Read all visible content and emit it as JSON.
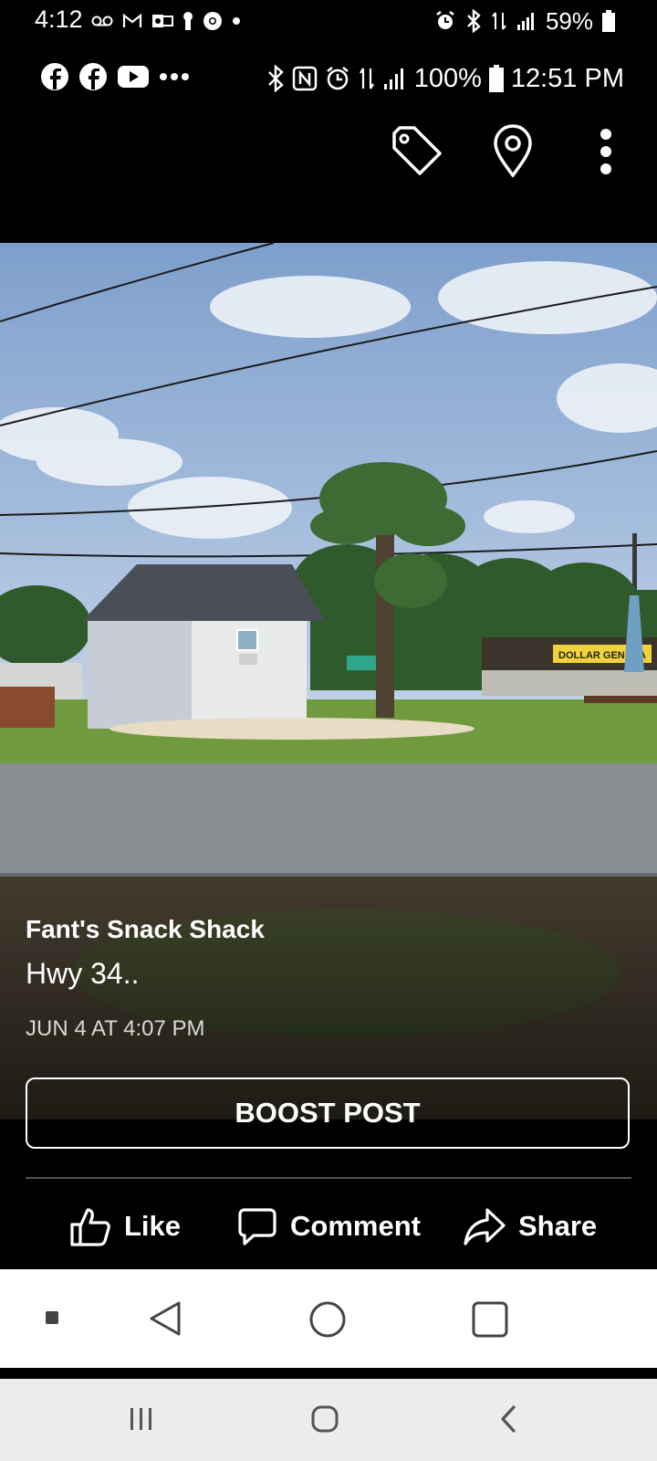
{
  "outer_status": {
    "time": "4:12",
    "battery": "59%",
    "icons": [
      "voicemail-icon",
      "gmail-icon",
      "outlook-icon",
      "keyhole-icon",
      "chrome-icon",
      "dot-icon",
      "alarm-icon",
      "bluetooth-icon",
      "data-icon",
      "signal-icon",
      "battery-icon"
    ]
  },
  "inner_status": {
    "battery": "100%",
    "time": "12:51 PM",
    "icons": [
      "facebook-icon",
      "facebook-icon",
      "youtube-icon",
      "more-dots-icon",
      "bluetooth-icon",
      "nfc-icon",
      "alarm-icon",
      "data-icon",
      "signal-icon",
      "battery-icon"
    ]
  },
  "toolbar": {
    "icons": [
      "tag-icon",
      "location-pin-icon",
      "more-vertical-icon"
    ]
  },
  "photo": {
    "sign_text": "DOLLAR GENERA"
  },
  "post": {
    "title": "Fant's Snack Shack",
    "subtitle": "Hwy 34..",
    "date": "JUN 4 AT 4:07 PM"
  },
  "boost_label": "BOOST POST",
  "actions": {
    "like": "Like",
    "comment": "Comment",
    "share": "Share"
  },
  "inner_nav": {
    "icons": [
      "square-dot-icon",
      "back-triangle-icon",
      "home-circle-icon",
      "recents-square-icon"
    ]
  },
  "outer_nav": {
    "icons": [
      "recents-icon",
      "home-icon",
      "back-icon"
    ]
  },
  "colors": {
    "accent": "#ffffff",
    "background": "#000000",
    "sky": "#8fb0d6",
    "grass": "#6f9a3e"
  }
}
